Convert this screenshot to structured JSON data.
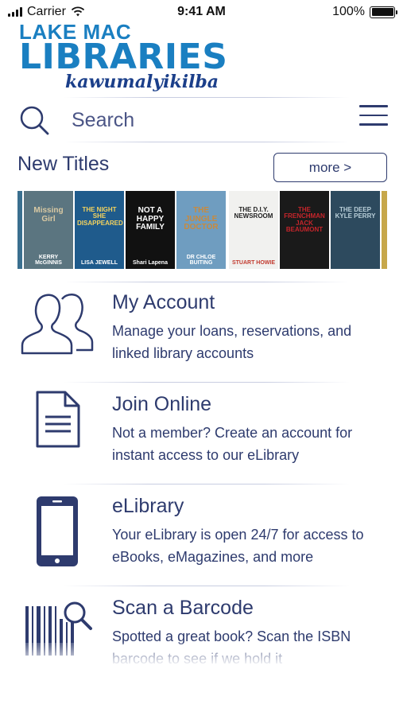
{
  "status_bar": {
    "carrier": "Carrier",
    "time": "9:41 AM",
    "battery": "100%",
    "signal_bars": 4,
    "wifi_icon": "wifi-icon",
    "battery_icon": "battery-icon"
  },
  "logo": {
    "line1": "LAKE MAC",
    "line2": "LIBRARIES",
    "line3": "kawumalyikilba"
  },
  "search": {
    "placeholder": "Search",
    "value": ""
  },
  "new_titles": {
    "heading": "New Titles",
    "more_label": "more >",
    "books": [
      {
        "title": "",
        "author": "",
        "bg": "#3a6f8f",
        "accent": "#e6e0d0"
      },
      {
        "title": "Missing Girl",
        "author": "KERRY McGINNIS",
        "bg": "#5b7580",
        "accent": "#d9c9a3"
      },
      {
        "title": "THE NIGHT SHE DISAPPEARED",
        "author": "LISA JEWELL",
        "bg": "#1f5b8c",
        "accent": "#f4d35e"
      },
      {
        "title": "NOT A HAPPY FAMILY",
        "author": "Shari Lapena",
        "bg": "#111111",
        "accent": "#ffffff"
      },
      {
        "title": "THE JUNGLE DOCTOR",
        "author": "DR CHLOE BUITING",
        "bg": "#6f9dc0",
        "accent": "#c98a3c"
      },
      {
        "title": "THE D.I.Y. NEWSROOM",
        "author": "STUART HOWIE",
        "bg": "#f1f1ef",
        "accent": "#c23a2f"
      },
      {
        "title": "THE FRENCHMAN JACK BEAUMONT",
        "author": "",
        "bg": "#1a1a1a",
        "accent": "#c6252b"
      },
      {
        "title": "THE DEEP KYLE PERRY",
        "author": "",
        "bg": "#2d4a5e",
        "accent": "#b9cfd9"
      },
      {
        "title": "",
        "author": "",
        "bg": "#c7a74a",
        "accent": "#333"
      }
    ]
  },
  "features": [
    {
      "title": "My Account",
      "description": "Manage your loans, reservations, and linked library accounts",
      "icon": "users-icon"
    },
    {
      "title": "Join Online",
      "description": "Not a member? Create an account for instant access to our eLibrary",
      "icon": "document-icon"
    },
    {
      "title": "eLibrary",
      "description": "Your eLibrary is open 24/7 for access to eBooks, eMagazines, and more",
      "icon": "smartphone-icon"
    },
    {
      "title": "Scan a Barcode",
      "description": "Spotted a great book? Scan the ISBN barcode to see if we hold it",
      "icon": "barcode-scan-icon"
    }
  ],
  "colors": {
    "primary": "#2e3b6e",
    "logo_blue": "#1a7fc1",
    "logo_navy": "#1b3f8a"
  }
}
